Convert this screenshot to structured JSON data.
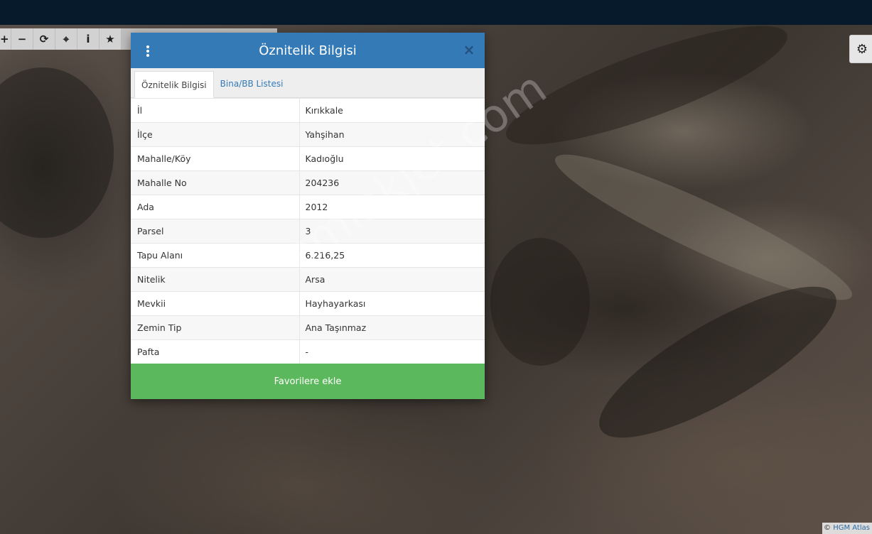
{
  "toolbar": {
    "buttons": [
      {
        "name": "zoom-in-button",
        "glyph": "+"
      },
      {
        "name": "zoom-out-button",
        "glyph": "−"
      },
      {
        "name": "refresh-button",
        "glyph": "⟳"
      },
      {
        "name": "locate-button",
        "glyph": "⌖"
      },
      {
        "name": "info-button",
        "glyph": "i"
      },
      {
        "name": "favorites-button",
        "glyph": "★"
      }
    ]
  },
  "settings": {
    "glyph": "⚙"
  },
  "modal": {
    "title": "Öznitelik Bilgisi",
    "close_glyph": "×",
    "tabs": [
      {
        "label": "Öznitelik Bilgisi",
        "active": true
      },
      {
        "label": "Bina/BB Listesi",
        "active": false
      }
    ],
    "rows": [
      {
        "key": "İl",
        "value": "Kırıkkale"
      },
      {
        "key": "İlçe",
        "value": "Yahşihan"
      },
      {
        "key": "Mahalle/Köy",
        "value": "Kadıoğlu"
      },
      {
        "key": "Mahalle No",
        "value": "204236"
      },
      {
        "key": "Ada",
        "value": "2012"
      },
      {
        "key": "Parsel",
        "value": "3"
      },
      {
        "key": "Tapu Alanı",
        "value": "6.216,25"
      },
      {
        "key": "Nitelik",
        "value": "Arsa"
      },
      {
        "key": "Mevkii",
        "value": "Hayhayarkası"
      },
      {
        "key": "Zemin Tip",
        "value": "Ana Taşınmaz"
      },
      {
        "key": "Pafta",
        "value": "-"
      }
    ],
    "favorite_button": "Favorilere ekle"
  },
  "attribution": {
    "copy": "©",
    "text": "HGM Atlas"
  },
  "watermark": "emlakjet.com",
  "colors": {
    "header": "#337ab7",
    "favorite": "#5cb85c",
    "topbar": "#061a2b"
  }
}
